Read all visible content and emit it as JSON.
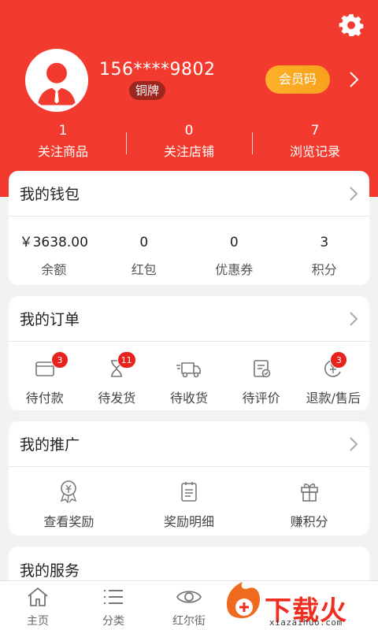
{
  "profile": {
    "phone": "156****9802",
    "level": "铜牌",
    "member_code_label": "会员码"
  },
  "stats": [
    {
      "num": "1",
      "label": "关注商品"
    },
    {
      "num": "0",
      "label": "关注店铺"
    },
    {
      "num": "7",
      "label": "浏览记录"
    }
  ],
  "wallet": {
    "title": "我的钱包",
    "items": [
      {
        "value": "￥3638.00",
        "label": "余额"
      },
      {
        "value": "0",
        "label": "红包"
      },
      {
        "value": "0",
        "label": "优惠券"
      },
      {
        "value": "3",
        "label": "积分"
      }
    ]
  },
  "orders": {
    "title": "我的订单",
    "items": [
      {
        "label": "待付款",
        "icon": "wallet-icon",
        "badge": "3"
      },
      {
        "label": "待发货",
        "icon": "hourglass-icon",
        "badge": "11"
      },
      {
        "label": "待收货",
        "icon": "truck-icon",
        "badge": ""
      },
      {
        "label": "待评价",
        "icon": "review-icon",
        "badge": ""
      },
      {
        "label": "退款/售后",
        "icon": "refund-icon",
        "badge": "3"
      }
    ]
  },
  "promotion": {
    "title": "我的推广",
    "items": [
      {
        "label": "查看奖励",
        "icon": "reward-icon"
      },
      {
        "label": "奖励明细",
        "icon": "detail-list-icon"
      },
      {
        "label": "赚积分",
        "icon": "gift-icon"
      }
    ]
  },
  "services": {
    "title": "我的服务"
  },
  "nav": [
    {
      "label": "主页",
      "icon": "home-icon"
    },
    {
      "label": "分类",
      "icon": "category-icon"
    },
    {
      "label": "红尔街",
      "icon": "eye-icon"
    }
  ],
  "watermark": {
    "text": "下载火",
    "sub": "xiazaihuo.com"
  },
  "colors": {
    "header_red": "#f23b2e",
    "member_orange": "#f6a11b",
    "badge_red": "#e8231e"
  }
}
